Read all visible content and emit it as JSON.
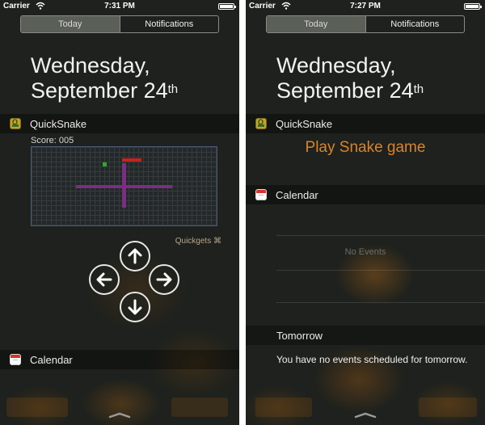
{
  "left": {
    "status": {
      "carrier": "Carrier",
      "time": "7:31 PM"
    },
    "tabs": {
      "today": "Today",
      "notifications": "Notifications"
    },
    "date": {
      "weekday": "Wednesday,",
      "month_day": "September 24",
      "suffix": "th"
    },
    "widget_quicksnake": {
      "title": "QuickSnake",
      "score": "Score: 005",
      "credit": "Quickgets ⌘",
      "controls": [
        "arrow-up-icon",
        "arrow-left-icon",
        "arrow-right-icon",
        "arrow-down-icon"
      ]
    },
    "widget_calendar": {
      "title": "Calendar"
    }
  },
  "right": {
    "status": {
      "carrier": "Carrier",
      "time": "7:27 PM"
    },
    "tabs": {
      "today": "Today",
      "notifications": "Notifications"
    },
    "date": {
      "weekday": "Wednesday,",
      "month_day": "September 24",
      "suffix": "th"
    },
    "widget_quicksnake": {
      "title": "QuickSnake",
      "play_label": "Play Snake game"
    },
    "widget_calendar": {
      "title": "Calendar",
      "empty_label": "No Events",
      "tomorrow_header": "Tomorrow",
      "tomorrow_message": "You have no events scheduled for tomorrow."
    }
  },
  "colors": {
    "accent_orange": "#d9842a",
    "snake_purple": "#7a2e82",
    "food_red": "#c8221e",
    "food_green": "#2ea82e"
  }
}
